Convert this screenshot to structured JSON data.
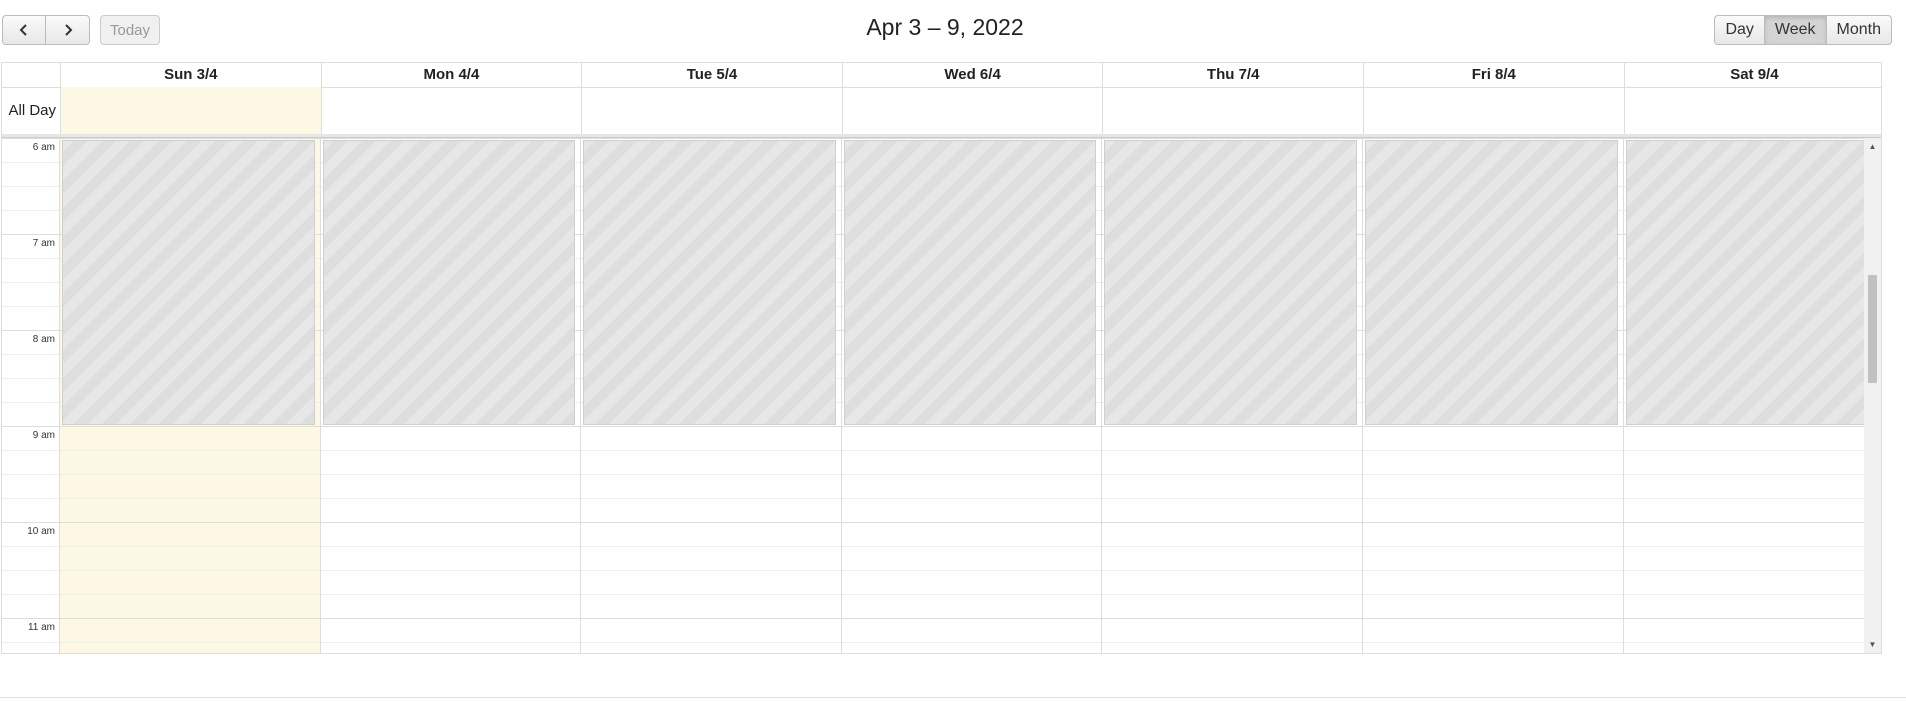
{
  "toolbar": {
    "prev_icon": "chevron-left-icon",
    "next_icon": "chevron-right-icon",
    "today_label": "Today",
    "title": "Apr 3 – 9, 2022",
    "views": [
      {
        "label": "Day",
        "active": false
      },
      {
        "label": "Week",
        "active": true
      },
      {
        "label": "Month",
        "active": false
      }
    ]
  },
  "calendar": {
    "all_day_label": "All Day",
    "days": [
      "Sun 3/4",
      "Mon 4/4",
      "Tue 5/4",
      "Wed 6/4",
      "Thu 7/4",
      "Fri 8/4",
      "Sat 9/4"
    ],
    "today_index": 0,
    "time_labels": [
      "6 am",
      "7 am",
      "8 am",
      "9 am",
      "10 am",
      "11 am"
    ],
    "blocked_hours": "6 am – 9 am",
    "colors": {
      "today_highlight": "#fcf8e3",
      "blocked_stripe_dark": "#dedede",
      "blocked_stripe_light": "#e7e7e7"
    }
  }
}
